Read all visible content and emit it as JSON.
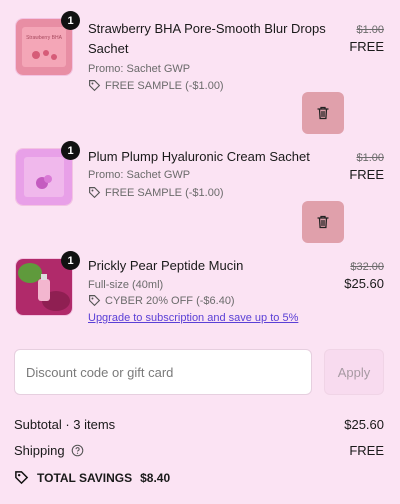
{
  "items": [
    {
      "qty": "1",
      "title": "Strawberry BHA Pore-Smooth Blur Drops Sachet",
      "variant": "Promo: Sachet GWP",
      "discount": "FREE SAMPLE (-$1.00)",
      "original_price": "$1.00",
      "price": "FREE",
      "thumb_text": "Strawberry BHA"
    },
    {
      "qty": "1",
      "title": "Plum Plump Hyaluronic Cream Sachet",
      "variant": "Promo: Sachet GWP",
      "discount": "FREE SAMPLE (-$1.00)",
      "original_price": "$1.00",
      "price": "FREE"
    },
    {
      "qty": "1",
      "title": "Prickly Pear Peptide Mucin",
      "variant": "Full-size (40ml)",
      "discount": "CYBER 20% OFF (-$6.40)",
      "original_price": "$32.00",
      "price": "$25.60",
      "upgrade_link": "Upgrade to subscription and save up to 5%"
    }
  ],
  "discount": {
    "placeholder": "Discount code or gift card",
    "apply_label": "Apply"
  },
  "summary": {
    "subtotal_label": "Subtotal · 3 items",
    "subtotal_value": "$25.60",
    "shipping_label": "Shipping",
    "shipping_value": "FREE",
    "savings_label": "TOTAL SAVINGS",
    "savings_value": "$8.40"
  },
  "colors": {
    "background": "#fbe3f3",
    "trash_button": "#e0a0ab",
    "link": "#5a3fd6"
  },
  "icons": [
    "tag-icon",
    "trash-icon",
    "help-circle-icon",
    "savings-tag-icon"
  ]
}
